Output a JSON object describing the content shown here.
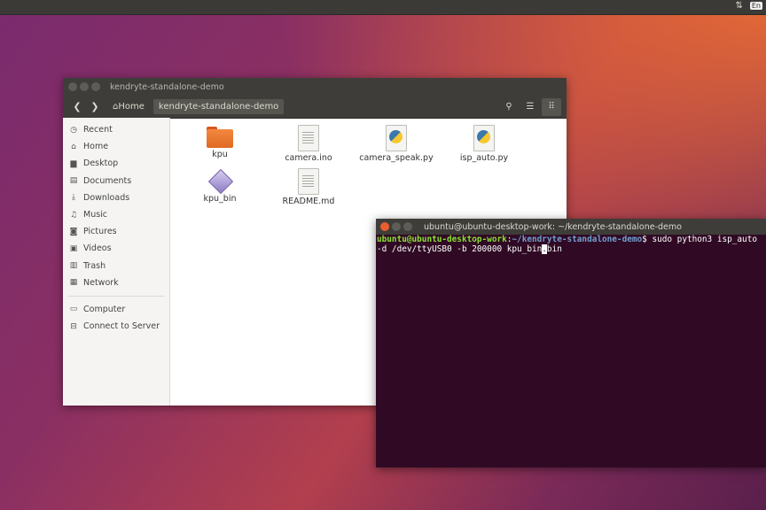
{
  "topbar": {
    "keyboard": "En"
  },
  "file_manager": {
    "title": "kendryte-standalone-demo",
    "breadcrumb": {
      "home": "Home",
      "current": "kendryte-standalone-demo"
    },
    "sidebar": [
      {
        "label": "Recent",
        "icon": "clock-icon"
      },
      {
        "label": "Home",
        "icon": "home-icon"
      },
      {
        "label": "Desktop",
        "icon": "desktop-icon"
      },
      {
        "label": "Documents",
        "icon": "documents-icon"
      },
      {
        "label": "Downloads",
        "icon": "downloads-icon"
      },
      {
        "label": "Music",
        "icon": "music-icon"
      },
      {
        "label": "Pictures",
        "icon": "pictures-icon"
      },
      {
        "label": "Videos",
        "icon": "videos-icon"
      },
      {
        "label": "Trash",
        "icon": "trash-icon"
      },
      {
        "label": "Network",
        "icon": "network-icon"
      },
      {
        "label": "Computer",
        "icon": "computer-icon"
      },
      {
        "label": "Connect to Server",
        "icon": "server-icon"
      }
    ],
    "files": [
      {
        "name": "kpu",
        "type": "folder"
      },
      {
        "name": "camera.ino",
        "type": "text"
      },
      {
        "name": "camera_speak.py",
        "type": "python"
      },
      {
        "name": "isp_auto.py",
        "type": "python"
      },
      {
        "name": "kpu_bin",
        "type": "binary"
      },
      {
        "name": "README.md",
        "type": "text"
      }
    ]
  },
  "terminal": {
    "title": "ubuntu@ubuntu-desktop-work: ~/kendryte-standalone-demo",
    "prompt_user": "ubuntu@ubuntu-desktop-work",
    "prompt_sep": ":",
    "prompt_path": "~/kendryte-standalone-demo",
    "prompt_end": "$ ",
    "command_line1": "sudo python3 isp_auto",
    "command_line2_a": "-d /dev/ttyUSB0 -b 200000 kpu_bin",
    "command_cursor": ".",
    "command_line2_b": "bin"
  },
  "colors": {
    "terminal_bg": "#300a24",
    "prompt_user": "#8ae234",
    "prompt_path": "#729fcf"
  }
}
